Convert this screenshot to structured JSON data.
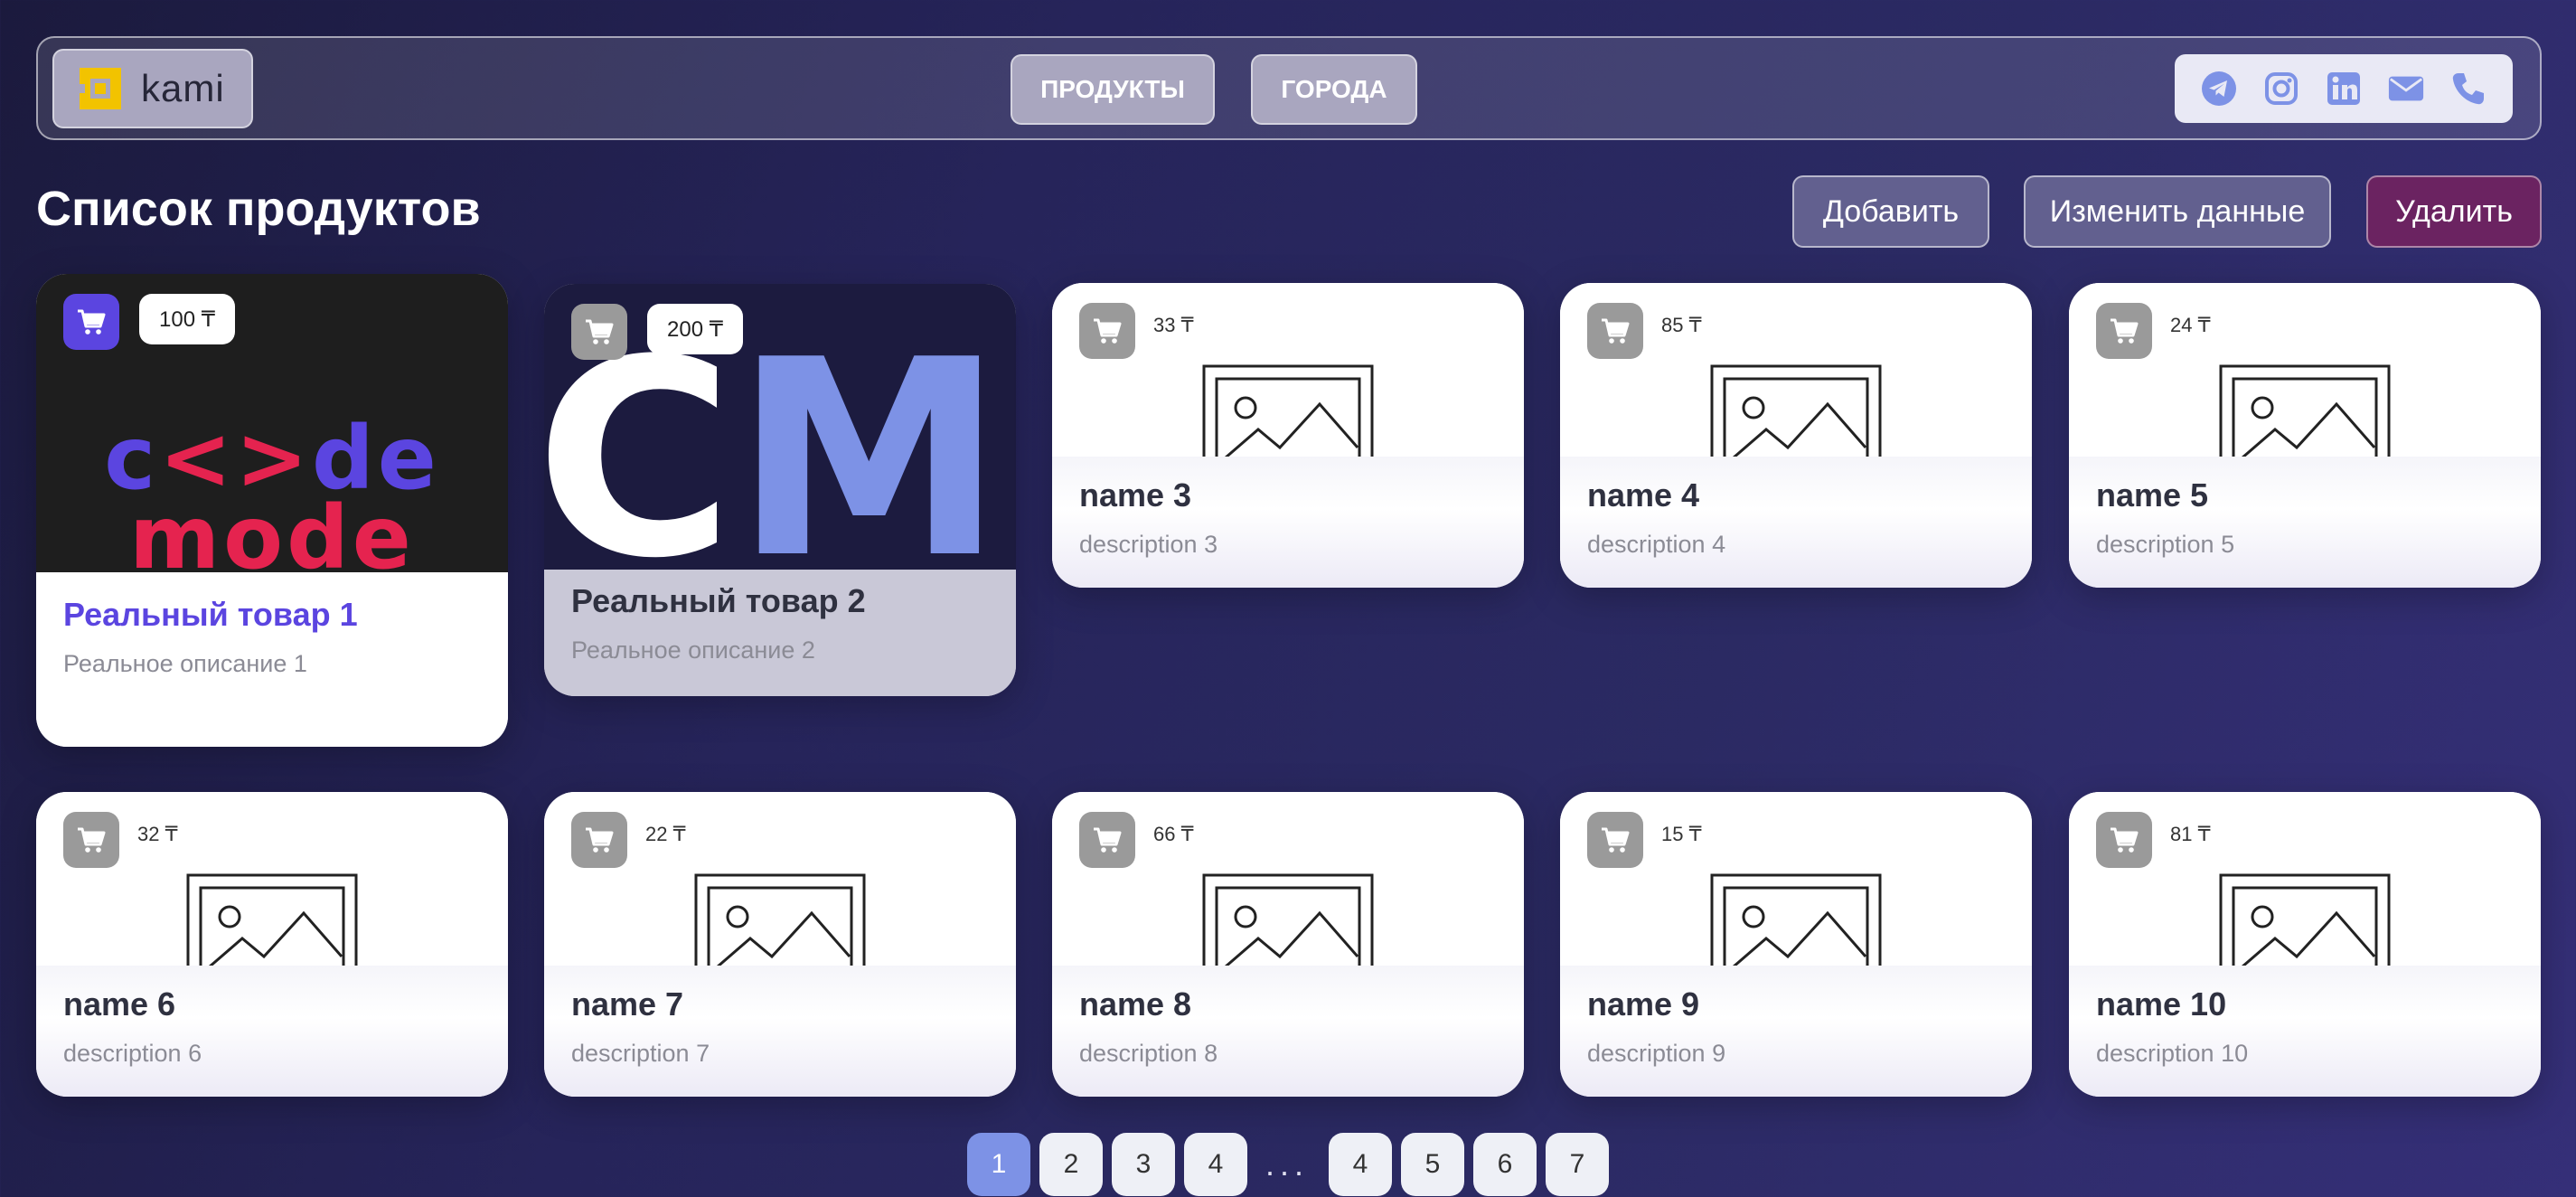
{
  "header": {
    "logo_text": "kami",
    "nav": [
      {
        "label": "ПРОДУКТЫ"
      },
      {
        "label": "ГОРОДА"
      }
    ],
    "socials": [
      "telegram-icon",
      "instagram-icon",
      "linkedin-icon",
      "mail-icon",
      "phone-icon"
    ]
  },
  "main": {
    "title": "Список продуктов",
    "actions": {
      "add": "Добавить",
      "edit": "Изменить данные",
      "delete": "Удалить"
    }
  },
  "featured": [
    {
      "price": "100 ₸",
      "name": "Реальный товар 1",
      "description": "Реальное описание 1",
      "image_text": [
        "c<>de",
        "mode"
      ]
    },
    {
      "price": "200 ₸",
      "name": "Реальный товар 2",
      "description": "Реальное описание 2",
      "image_text": [
        "CM"
      ]
    }
  ],
  "products": [
    {
      "price": "33 ₸",
      "name": "name 3",
      "description": "description 3"
    },
    {
      "price": "85 ₸",
      "name": "name 4",
      "description": "description 4"
    },
    {
      "price": "24 ₸",
      "name": "name 5",
      "description": "description 5"
    },
    {
      "price": "32 ₸",
      "name": "name 6",
      "description": "description 6"
    },
    {
      "price": "22 ₸",
      "name": "name 7",
      "description": "description 7"
    },
    {
      "price": "66 ₸",
      "name": "name 8",
      "description": "description 8"
    },
    {
      "price": "15 ₸",
      "name": "name 9",
      "description": "description 9"
    },
    {
      "price": "81 ₸",
      "name": "name 10",
      "description": "description 10"
    }
  ],
  "pagination": {
    "pages": [
      "1",
      "2",
      "3",
      "4",
      "...",
      "4",
      "5",
      "6",
      "7"
    ],
    "active": "1"
  },
  "colors": {
    "accent": "#5b45e0",
    "pagination_active": "#7d92e6",
    "danger": "#6b2361",
    "logo_yellow": "#f2c300"
  }
}
